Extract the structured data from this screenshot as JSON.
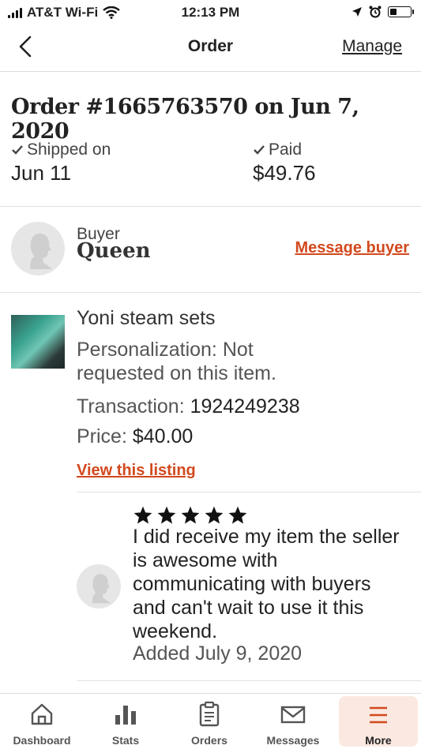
{
  "status_bar": {
    "carrier": "AT&T Wi-Fi",
    "time": "12:13 PM",
    "battery_level": 0.35
  },
  "nav": {
    "title": "Order",
    "manage_label": "Manage",
    "back_icon": "chevron-left-icon"
  },
  "order": {
    "heading": "Order #1665763570 on Jun 7, 2020",
    "shipped_label": "Shipped on",
    "shipped_date": "Jun 11",
    "paid_label": "Paid",
    "paid_amount": "$49.76"
  },
  "buyer": {
    "label": "Buyer",
    "name": "Queen",
    "message_label": "Message buyer"
  },
  "item": {
    "title": "Yoni steam sets",
    "personalization_line1": "Personalization: Not",
    "personalization_line2": "requested on this item.",
    "transaction_label": "Transaction:",
    "transaction_id": "1924249238",
    "price_label": "Price:",
    "price": "$40.00",
    "view_listing_label": "View this listing"
  },
  "review": {
    "rating": 5,
    "text": "I did receive my item the seller is awesome with communicating with buyers and can't wait to use it this weekend.",
    "date": "Added July 9, 2020"
  },
  "tabs": [
    {
      "label": "Dashboard",
      "icon": "home-icon"
    },
    {
      "label": "Stats",
      "icon": "bar-chart-icon"
    },
    {
      "label": "Orders",
      "icon": "clipboard-icon"
    },
    {
      "label": "Messages",
      "icon": "envelope-icon"
    },
    {
      "label": "More",
      "icon": "menu-icon"
    }
  ],
  "colors": {
    "accent": "#d2491d",
    "active_tab_bg": "#fbe9e1"
  }
}
